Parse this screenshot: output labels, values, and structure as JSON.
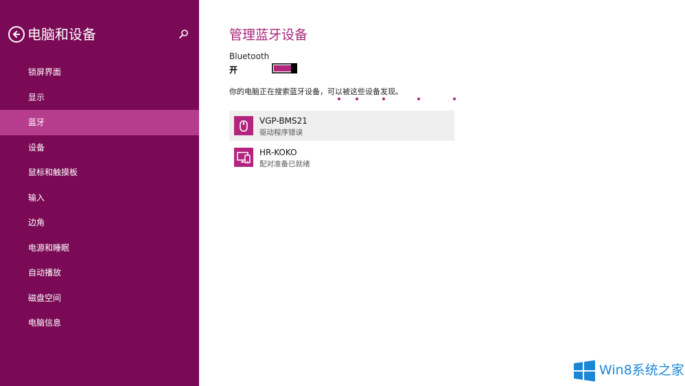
{
  "sidebar": {
    "title": "电脑和设备",
    "items": [
      {
        "label": "锁屏界面"
      },
      {
        "label": "显示"
      },
      {
        "label": "蓝牙"
      },
      {
        "label": "设备"
      },
      {
        "label": "鼠标和触摸板"
      },
      {
        "label": "输入"
      },
      {
        "label": "边角"
      },
      {
        "label": "电源和睡眠"
      },
      {
        "label": "自动播放"
      },
      {
        "label": "磁盘空间"
      },
      {
        "label": "电脑信息"
      }
    ],
    "active_item": "蓝牙"
  },
  "main": {
    "title": "管理蓝牙设备",
    "bluetooth_label": "Bluetooth",
    "bluetooth_state": "开",
    "bluetooth_on": true,
    "status_text": "你的电脑正在搜索蓝牙设备，可以被这些设备发现。",
    "devices": [
      {
        "name": "VGP-BMS21",
        "status": "驱动程序错误",
        "icon": "mouse-icon",
        "selected": true
      },
      {
        "name": "HR-KOKO",
        "status": "配对准备已就绪",
        "icon": "phone-pc-icon",
        "selected": false
      }
    ]
  },
  "watermark": {
    "text": "Win8系统之家"
  },
  "colors": {
    "sidebar_bg": "#7a0a55",
    "active_item_bg": "#b63d8e",
    "accent": "#a8247a",
    "toggle_fill": "#b2247e",
    "watermark_blue": "#1a86d6"
  }
}
